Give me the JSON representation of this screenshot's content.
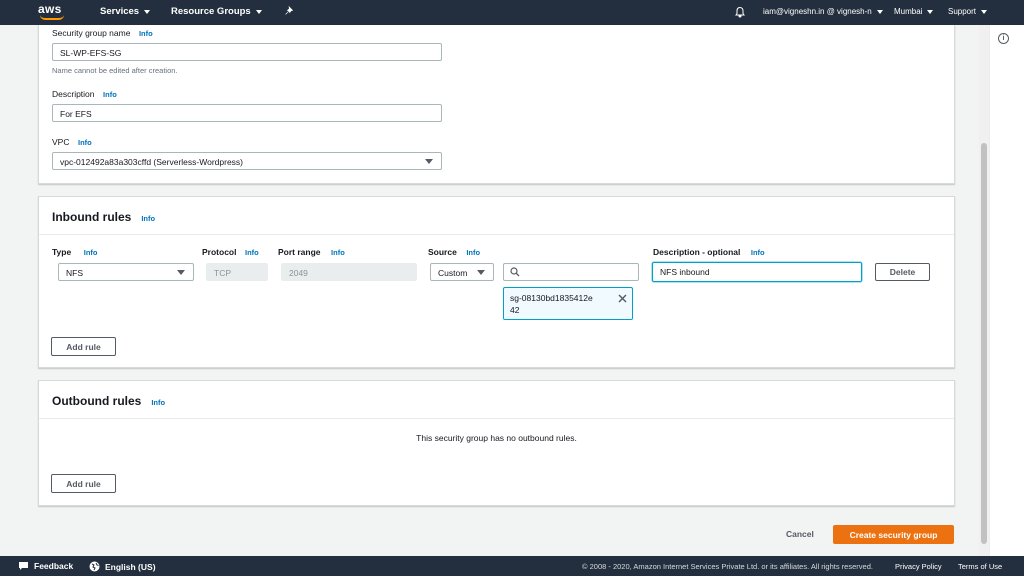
{
  "nav": {
    "logo": "aws",
    "services": "Services",
    "resource_groups": "Resource Groups",
    "account": "iam@vigneshn.in @ vignesh-n",
    "region": "Mumbai",
    "support": "Support"
  },
  "basic": {
    "sg_name_label": "Security group name",
    "sg_name_info": "Info",
    "sg_name_value": "SL-WP-EFS-SG",
    "sg_name_hint": "Name cannot be edited after creation.",
    "desc_label": "Description",
    "desc_info": "Info",
    "desc_value": "For EFS",
    "vpc_label": "VPC",
    "vpc_info": "Info",
    "vpc_value": "vpc-012492a83a303cffd (Serverless-Wordpress)"
  },
  "inbound": {
    "title": "Inbound rules",
    "title_info": "Info",
    "col_type": "Type",
    "col_type_info": "Info",
    "col_protocol": "Protocol",
    "col_protocol_info": "Info",
    "col_port": "Port range",
    "col_port_info": "Info",
    "col_source": "Source",
    "col_source_info": "Info",
    "col_desc": "Description - optional",
    "col_desc_info": "Info",
    "row": {
      "type": "NFS",
      "protocol": "TCP",
      "port": "2049",
      "source": "Custom",
      "search_value": "",
      "token_line1": "sg-08130bd1835412e",
      "token_line2": "42",
      "description": "NFS inbound",
      "delete": "Delete"
    },
    "add_rule": "Add rule"
  },
  "outbound": {
    "title": "Outbound rules",
    "title_info": "Info",
    "empty": "This security group has no outbound rules.",
    "add_rule": "Add rule"
  },
  "actions": {
    "cancel": "Cancel",
    "create": "Create security group"
  },
  "footer": {
    "feedback": "Feedback",
    "language": "English (US)",
    "copyright": "© 2008 - 2020, Amazon Internet Services Private Ltd. or its affiliates. All rights reserved.",
    "privacy": "Privacy Policy",
    "terms": "Terms of Use"
  },
  "colors": {
    "nav_bg": "#232f3e",
    "primary": "#ec7211",
    "link": "#0073bb",
    "focus": "#00a1c9"
  }
}
